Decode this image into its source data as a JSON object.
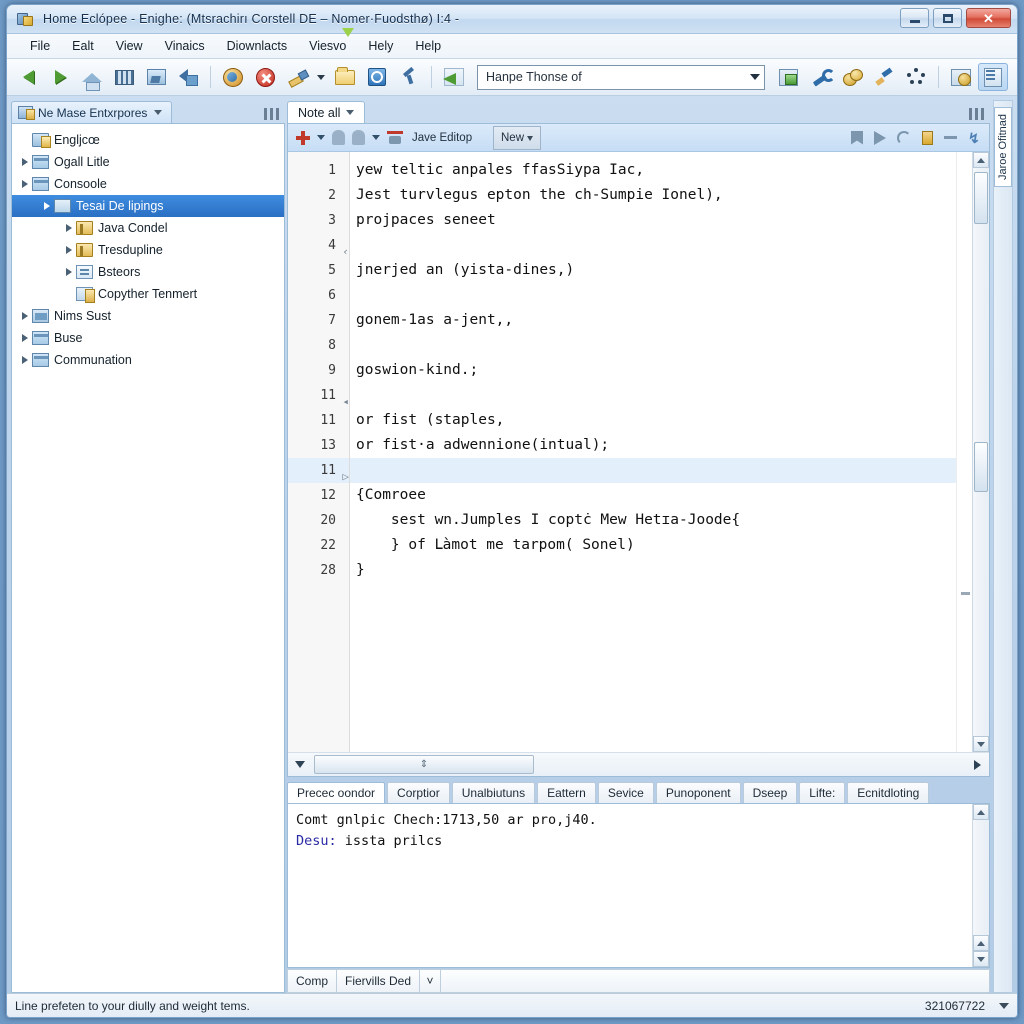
{
  "window": {
    "title": "Home Eclópee - Enighe: (Mtsrachirı Corstell DE  –  Nomer·Fuodsthø) I:4 -",
    "minimize_label": "",
    "maximize_label": "",
    "close_label": "✕"
  },
  "menu": {
    "items": [
      "File",
      "Ealt",
      "View",
      "Vinaics",
      "Diownlacts",
      "Viesvo",
      "Hely",
      "Help"
    ]
  },
  "toolbar": {
    "combo_value": "Hanpe Thonse of",
    "icons": [
      "back-arrow-icon",
      "forward-arrow-icon",
      "home-icon",
      "grid-icon",
      "image-icon",
      "backlink-icon",
      "run-icon",
      "stop-icon",
      "brush-icon",
      "brush-dropdown-caret",
      "folder-icon",
      "camera-icon",
      "pin-icon",
      "open-perspective-icon",
      "save-icon",
      "wrench-icon",
      "coins-icon",
      "pen-icon",
      "dots-icon",
      "database-icon",
      "document-icon",
      "person-icon"
    ]
  },
  "explorer": {
    "tab_label": "Ne Mase Entxrpores",
    "minmax_label": "restore-icon",
    "tree": [
      {
        "label": "Engljcœ",
        "indent": 0,
        "twist": "none",
        "icon": "project-icon",
        "selected": false
      },
      {
        "label": "Ogall Litle",
        "indent": 0,
        "twist": "closed",
        "icon": "folder-icon",
        "selected": false
      },
      {
        "label": "Consoole",
        "indent": 0,
        "twist": "closed",
        "icon": "folder-icon",
        "selected": false
      },
      {
        "label": "Tesai De lipings",
        "indent": 1,
        "twist": "closed",
        "icon": "source-icon",
        "selected": true
      },
      {
        "label": "Java Condel",
        "indent": 2,
        "twist": "closed",
        "icon": "package-icon",
        "selected": false
      },
      {
        "label": "Tresdupline",
        "indent": 2,
        "twist": "closed",
        "icon": "package-icon",
        "selected": false
      },
      {
        "label": "Bsteors",
        "indent": 2,
        "twist": "closed",
        "icon": "file-icon",
        "selected": false
      },
      {
        "label": "Copyther Tenmert",
        "indent": 2,
        "twist": "none",
        "icon": "library-icon",
        "selected": false
      },
      {
        "label": "Nims Sust",
        "indent": 0,
        "twist": "closed",
        "icon": "jre-icon",
        "selected": false
      },
      {
        "label": "Buse",
        "indent": 0,
        "twist": "closed",
        "icon": "folder-icon",
        "selected": false
      },
      {
        "label": "Communation",
        "indent": 0,
        "twist": "closed",
        "icon": "folder-icon",
        "selected": false
      }
    ]
  },
  "editor": {
    "tab_label": "Note all",
    "minmax_label": "restore-icon",
    "toolbar": {
      "tip_label": "New",
      "mode_label": "Jave Editop",
      "icons": [
        "add-icon",
        "add-caret",
        "ghost-icon",
        "ghost2-icon",
        "ghost-caret",
        "java-editor-icon"
      ],
      "right_icons": [
        "bookmark-icon",
        "play-icon",
        "arc-icon",
        "note-icon",
        "dash-icon",
        "zigzag-icon"
      ]
    },
    "lines": [
      {
        "num": "1",
        "text": "yew teltic anpales ffasSiypa Iac,",
        "highlight": false,
        "mark": ""
      },
      {
        "num": "2",
        "text": "Jest turvlegus epton the ch-Sumpie Ionel),",
        "highlight": false,
        "mark": ""
      },
      {
        "num": "3",
        "text": "projpaces seneet",
        "highlight": false,
        "mark": ""
      },
      {
        "num": "4",
        "text": "",
        "highlight": false,
        "mark": "‹"
      },
      {
        "num": "5",
        "text": "jnerjed an (yista-dines,)",
        "highlight": false,
        "mark": ""
      },
      {
        "num": "6",
        "text": "",
        "highlight": false,
        "mark": ""
      },
      {
        "num": "7",
        "text": "gonem-1as a-jent,,",
        "highlight": false,
        "mark": ""
      },
      {
        "num": "8",
        "text": "",
        "highlight": false,
        "mark": ""
      },
      {
        "num": "9",
        "text": "goswion-kind.;",
        "highlight": false,
        "mark": ""
      },
      {
        "num": "11",
        "text": "",
        "highlight": false,
        "mark": "◂"
      },
      {
        "num": "11",
        "text": "or fist (staples,",
        "highlight": false,
        "mark": ""
      },
      {
        "num": "13",
        "text": "or fist·a adwennione(intual);",
        "highlight": false,
        "mark": ""
      },
      {
        "num": "11",
        "text": "",
        "highlight": true,
        "mark": "▷"
      },
      {
        "num": "12",
        "text": "{Comroee",
        "highlight": false,
        "mark": ""
      },
      {
        "num": "20",
        "text": "    sest wn.Jumples I coptċ Mew Hetɪa-Joode{",
        "highlight": false,
        "mark": ""
      },
      {
        "num": "22",
        "text": "    } of Ⅼàmot me tarpom( Sonel)",
        "highlight": false,
        "mark": ""
      },
      {
        "num": "28",
        "text": "}",
        "highlight": false,
        "mark": ""
      }
    ],
    "hscroll_thumb_label": "⇕"
  },
  "console": {
    "tabs": [
      {
        "label": "Precec oondor",
        "active": true
      },
      {
        "label": "Corptior",
        "active": false
      },
      {
        "label": "Unalbiutuns",
        "active": false
      },
      {
        "label": "Eattern",
        "active": false
      },
      {
        "label": "Sevice",
        "active": false
      },
      {
        "label": "Punoponent",
        "active": false
      },
      {
        "label": "Dseep",
        "active": false
      },
      {
        "label": "Lifte:",
        "active": false
      },
      {
        "label": "Ecnitdloting",
        "active": false
      }
    ],
    "lines": [
      {
        "label": "",
        "text": "Comt gnlpic Chech:1713,50 ar pro,j40."
      },
      {
        "label": "Desu:",
        "text": " issta prilcs"
      }
    ]
  },
  "minitabs": {
    "items": [
      "Comp",
      "Fiervills Ded"
    ],
    "caret_label": "˅"
  },
  "fastview": {
    "vertical_tab_label": "Jaroe Ofitnad"
  },
  "statusbar": {
    "message": "Line prefeten to your diully and weight tems.",
    "counter": "321067722",
    "caret_label": "▽"
  },
  "colors": {
    "selection_blue": "#2a6fc4",
    "keyword_purple": "#4646b4",
    "string_blue": "#2a2aa5",
    "accent_red": "#c0392b",
    "highlight_row": "#e3effb"
  }
}
